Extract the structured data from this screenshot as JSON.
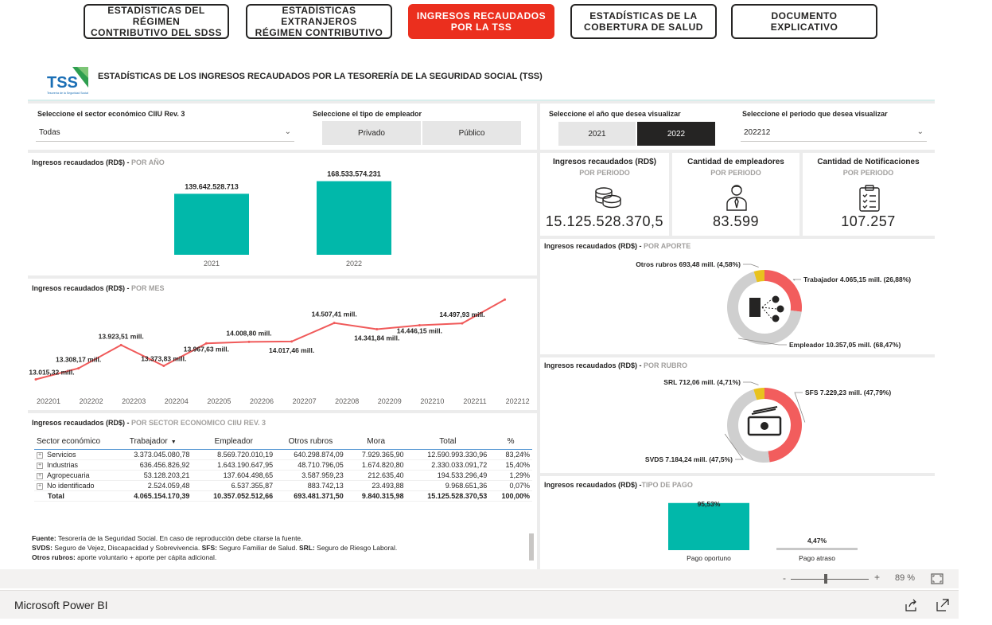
{
  "nav": {
    "buttons": [
      {
        "label": "ESTADÍSTICAS DEL RÉGIMEN\nCONTRIBUTIVO DEL SDSS"
      },
      {
        "label": "ESTADÍSTICAS EXTRANJEROS\nRÉGIMEN CONTRIBUTIVO"
      },
      {
        "label": "INGRESOS RECAUDADOS\nPOR LA TSS"
      },
      {
        "label": "ESTADÍSTICAS DE LA\nCOBERTURA DE SALUD"
      },
      {
        "label": "DOCUMENTO EXPLICATIVO"
      }
    ],
    "active_index": 2,
    "active_color": "#eb2f1e"
  },
  "header": {
    "logo_text": "TSS",
    "logo_caption": "Tesorería de la Seguridad Social",
    "title": "ESTADÍSTICAS DE LOS INGRESOS RECAUDADOS POR LA TESORERÍA DE LA SEGURIDAD SOCIAL (TSS)"
  },
  "slicers": {
    "sector": {
      "label": "Seleccione el sector económico CIIU Rev. 3",
      "value": "Todas"
    },
    "employer": {
      "label": "Seleccione el tipo de empleador",
      "options": [
        "Privado",
        "Público"
      ]
    },
    "year": {
      "label": "Seleccione el año que desea visualizar",
      "options": [
        "2021",
        "2022"
      ],
      "selected": "2022"
    },
    "period": {
      "label": "Seleccione el periodo que desea visualizar",
      "value": "202212"
    }
  },
  "kpis": [
    {
      "title": "Ingresos recaudados (RD$)",
      "sub": "POR PERIODO",
      "value": "15.125.528.370,5",
      "icon": "coins-icon"
    },
    {
      "title": "Cantidad de empleadores",
      "sub": "POR PERIODO",
      "value": "83.599",
      "icon": "employer-person-icon"
    },
    {
      "title": "Cantidad de Notificaciones",
      "sub": "POR PERIODO",
      "value": "107.257",
      "icon": "clipboard-checklist-icon"
    }
  ],
  "titles": {
    "by_year": {
      "main": "Ingresos recaudados (RD$) - ",
      "sub": "POR  AÑO"
    },
    "by_month": {
      "main": "Ingresos recaudados (RD$) - ",
      "sub": "POR MES"
    },
    "by_sector": {
      "main": "Ingresos recaudados (RD$) - ",
      "sub": "POR SECTOR ECONOMICO CIIU REV. 3"
    },
    "by_contribution": {
      "main": "Ingresos recaudados (RD$) - ",
      "sub": "POR APORTE"
    },
    "by_item": {
      "main": "Ingresos recaudados (RD$) - ",
      "sub": "POR RUBRO"
    },
    "by_payment": {
      "main": "Ingresos recaudados (RD$) -",
      "sub": "TIPO DE PAGO"
    }
  },
  "chart_data": [
    {
      "type": "bar",
      "categories": [
        "2021",
        "2022"
      ],
      "values": [
        139642528713,
        168533574231
      ],
      "labels": [
        "139.642.528.713",
        "168.533.574.231"
      ],
      "color": "#01b8aa"
    },
    {
      "type": "line",
      "x": [
        "202201",
        "202202",
        "202203",
        "202204",
        "202205",
        "202206",
        "202207",
        "202208",
        "202209",
        "202210",
        "202211",
        "202212"
      ],
      "values": [
        13015.32,
        13308.17,
        13923.51,
        13373.83,
        13967.63,
        14008.8,
        14017.46,
        14507.41,
        14341.84,
        14446.15,
        14497.93,
        15125.53
      ],
      "labels": [
        "13.015,32 mill.",
        "13.308,17 mill.",
        "13.923,51 mill.",
        "13.373,83 mill.",
        "13.967,63 mill.",
        "14.008,80 mill.",
        "14.017,46 mill.",
        "14.507,41 mill.",
        "14.341,84 mill.",
        "14.446,15 mill.",
        "14.497,93 mill.",
        "15.125,53 mill."
      ],
      "color": "#f05a5a"
    },
    {
      "type": "pie",
      "slices": [
        {
          "name": "Trabajador",
          "value": 4065.15,
          "label": "Trabajador 4.065,15 mill. (26,88%)",
          "color": "#f25d5d"
        },
        {
          "name": "Empleador",
          "value": 10357.05,
          "label": "Empleador 10.357,05 mill. (68,47%)",
          "color": "#cfcfcf"
        },
        {
          "name": "Otros rubros",
          "value": 693.48,
          "label": "Otros rubros 693,48 mill. (4,58%)",
          "color": "#e8c21e"
        }
      ]
    },
    {
      "type": "pie",
      "slices": [
        {
          "name": "SFS",
          "value": 7229.23,
          "label": "SFS 7.229,23 mill. (47,79%)",
          "color": "#f25d5d"
        },
        {
          "name": "SVDS",
          "value": 7184.24,
          "label": "SVDS 7.184,24 mill. (47,5%)",
          "color": "#cfcfcf"
        },
        {
          "name": "SRL",
          "value": 712.06,
          "label": "SRL 712,06 mill. (4,71%)",
          "color": "#e8c21e"
        }
      ]
    },
    {
      "type": "bar",
      "categories": [
        "Pago oportuno",
        "Pago atraso"
      ],
      "values": [
        95.53,
        4.47
      ],
      "labels": [
        "95,53%",
        "4,47%"
      ],
      "colors": [
        "#01b8aa",
        "#c8c8c8"
      ]
    }
  ],
  "table": {
    "headers": [
      "Sector económico",
      "Trabajador",
      "Empleador",
      "Otros rubros",
      "Mora",
      "Total",
      "%"
    ],
    "rows": [
      [
        "Servicios",
        "3.373.045.080,78",
        "8.569.720.010,19",
        "640.298.874,09",
        "7.929.365,90",
        "12.590.993.330,96",
        "83,24%"
      ],
      [
        "Industrias",
        "636.456.826,92",
        "1.643.190.647,95",
        "48.710.796,05",
        "1.674.820,80",
        "2.330.033.091,72",
        "15,40%"
      ],
      [
        "Agropecuaria",
        "53.128.203,21",
        "137.604.498,65",
        "3.587.959,23",
        "212.635,40",
        "194.533.296,49",
        "1,29%"
      ],
      [
        "No identificado",
        "2.524.059,48",
        "6.537.355,87",
        "883.742,13",
        "23.493,88",
        "9.968.651,36",
        "0,07%"
      ]
    ],
    "total": [
      "Total",
      "4.065.154.170,39",
      "10.357.052.512,66",
      "693.481.371,50",
      "9.840.315,98",
      "15.125.528.370,53",
      "100,00%"
    ]
  },
  "footnote": {
    "l1_b": "Fuente:",
    "l1": " Tesorería de la Seguridad Social. En caso de reproducción debe citarse la fuente.",
    "l2_b1": "SVDS:",
    "l2_1": " Seguro de Vejez, Discapacidad y Sobrevivencia. ",
    "l2_b2": "SFS:",
    "l2_2": " Seguro Familiar de Salud. ",
    "l2_b3": "SRL:",
    "l2_3": " Seguro de Riesgo Laboral.",
    "l3_b": "Otros rubros:",
    "l3": " aporte voluntario + aporte per cápita adicional."
  },
  "zoom": {
    "minus": "-",
    "plus": "+",
    "level": "89 %"
  },
  "footer": {
    "brand": "Microsoft Power BI"
  }
}
